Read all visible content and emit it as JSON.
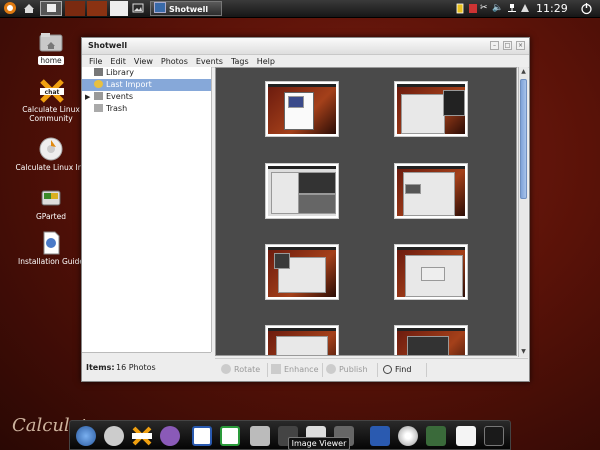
{
  "top_panel": {
    "task_button_label": "Shotwell",
    "clock": "11:29"
  },
  "desktop_icons": [
    {
      "label": "home"
    },
    {
      "label": "Calculate Linux Community"
    },
    {
      "label": "Calculate Linux Ins"
    },
    {
      "label": "GParted"
    },
    {
      "label": "Installation Guide"
    }
  ],
  "window": {
    "title": "Shotwell",
    "menu": [
      "File",
      "Edit",
      "View",
      "Photos",
      "Events",
      "Tags",
      "Help"
    ],
    "sidebar": {
      "items": [
        {
          "label": "Library"
        },
        {
          "label": "Last Import"
        },
        {
          "label": "Events"
        },
        {
          "label": "Trash"
        }
      ],
      "selected": "Last Import"
    },
    "status": {
      "label": "Items:",
      "value": "16 Photos"
    },
    "toolbar": {
      "rotate": "Rotate",
      "enhance": "Enhance",
      "publish": "Publish",
      "find": "Find"
    }
  },
  "dock": {
    "tooltip": "Image Viewer"
  },
  "wallpaper": {
    "brand_text": "Calculate"
  },
  "colors": {
    "selection": "#86a8d9",
    "viewer_bg": "#4a4a4a",
    "panel": "#1f1f1f"
  }
}
